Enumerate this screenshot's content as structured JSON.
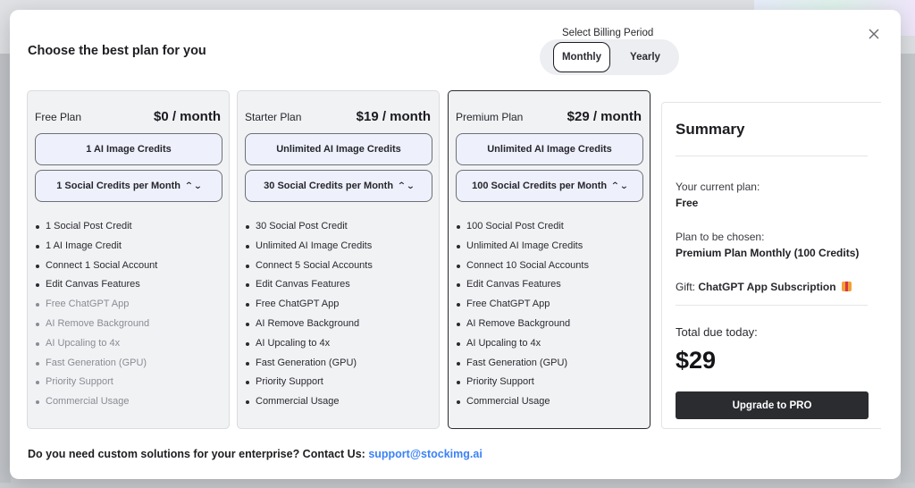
{
  "modal": {
    "title": "Choose the best plan for you",
    "close_icon": "close-icon"
  },
  "billing": {
    "label": "Select Billing Period",
    "options": [
      "Monthly",
      "Yearly"
    ],
    "selected": "Monthly"
  },
  "plans": [
    {
      "name": "Free Plan",
      "price": "$0 / month",
      "image_credits": "1 AI Image Credits",
      "social_credits": "1 Social Credits per Month",
      "features": [
        {
          "text": "1 Social Post Credit",
          "included": true
        },
        {
          "text": "1 AI Image Credit",
          "included": true
        },
        {
          "text": "Connect 1 Social Account",
          "included": true
        },
        {
          "text": "Edit Canvas Features",
          "included": true
        },
        {
          "text": "Free ChatGPT App",
          "included": false
        },
        {
          "text": "AI Remove Background",
          "included": false
        },
        {
          "text": "AI Upcaling to 4x",
          "included": false
        },
        {
          "text": "Fast Generation (GPU)",
          "included": false
        },
        {
          "text": "Priority Support",
          "included": false
        },
        {
          "text": "Commercial Usage",
          "included": false
        }
      ]
    },
    {
      "name": "Starter Plan",
      "price": "$19 / month",
      "image_credits": "Unlimited AI Image Credits",
      "social_credits": "30 Social Credits per Month",
      "features": [
        {
          "text": "30 Social Post Credit",
          "included": true
        },
        {
          "text": "Unlimited AI Image Credits",
          "included": true
        },
        {
          "text": "Connect 5 Social Accounts",
          "included": true
        },
        {
          "text": "Edit Canvas Features",
          "included": true
        },
        {
          "text": "Free ChatGPT App",
          "included": true
        },
        {
          "text": "AI Remove Background",
          "included": true
        },
        {
          "text": "AI Upcaling to 4x",
          "included": true
        },
        {
          "text": "Fast Generation (GPU)",
          "included": true
        },
        {
          "text": "Priority Support",
          "included": true
        },
        {
          "text": "Commercial Usage",
          "included": true
        }
      ]
    },
    {
      "name": "Premium Plan",
      "price": "$29 / month",
      "image_credits": "Unlimited AI Image Credits",
      "social_credits": "100 Social Credits per Month",
      "features": [
        {
          "text": "100 Social Post Credit",
          "included": true
        },
        {
          "text": "Unlimited AI Image Credits",
          "included": true
        },
        {
          "text": "Connect 10 Social Accounts",
          "included": true
        },
        {
          "text": "Edit Canvas Features",
          "included": true
        },
        {
          "text": "Free ChatGPT App",
          "included": true
        },
        {
          "text": "AI Remove Background",
          "included": true
        },
        {
          "text": "AI Upcaling to 4x",
          "included": true
        },
        {
          "text": "Fast Generation (GPU)",
          "included": true
        },
        {
          "text": "Priority Support",
          "included": true
        },
        {
          "text": "Commercial Usage",
          "included": true
        }
      ]
    }
  ],
  "summary": {
    "title": "Summary",
    "current_plan_label": "Your current plan:",
    "current_plan_value": "Free",
    "chosen_plan_label": "Plan to be chosen:",
    "chosen_plan_value": "Premium Plan Monthly (100 Credits)",
    "gift_label": "Gift:",
    "gift_value": "ChatGPT App Subscription",
    "gift_icon": "gift-icon",
    "total_label": "Total due today:",
    "total_value": "$29",
    "upgrade_label": "Upgrade to PRO"
  },
  "footer": {
    "contact_text": "Do you need custom solutions for your enterprise? Contact Us:",
    "contact_email": "support@stockimg.ai"
  },
  "colors": {
    "accent_link": "#3b82f6",
    "button_dark": "#2b2c30",
    "card_bg": "#f1f2f4",
    "pill_bg": "#eef0fb"
  }
}
